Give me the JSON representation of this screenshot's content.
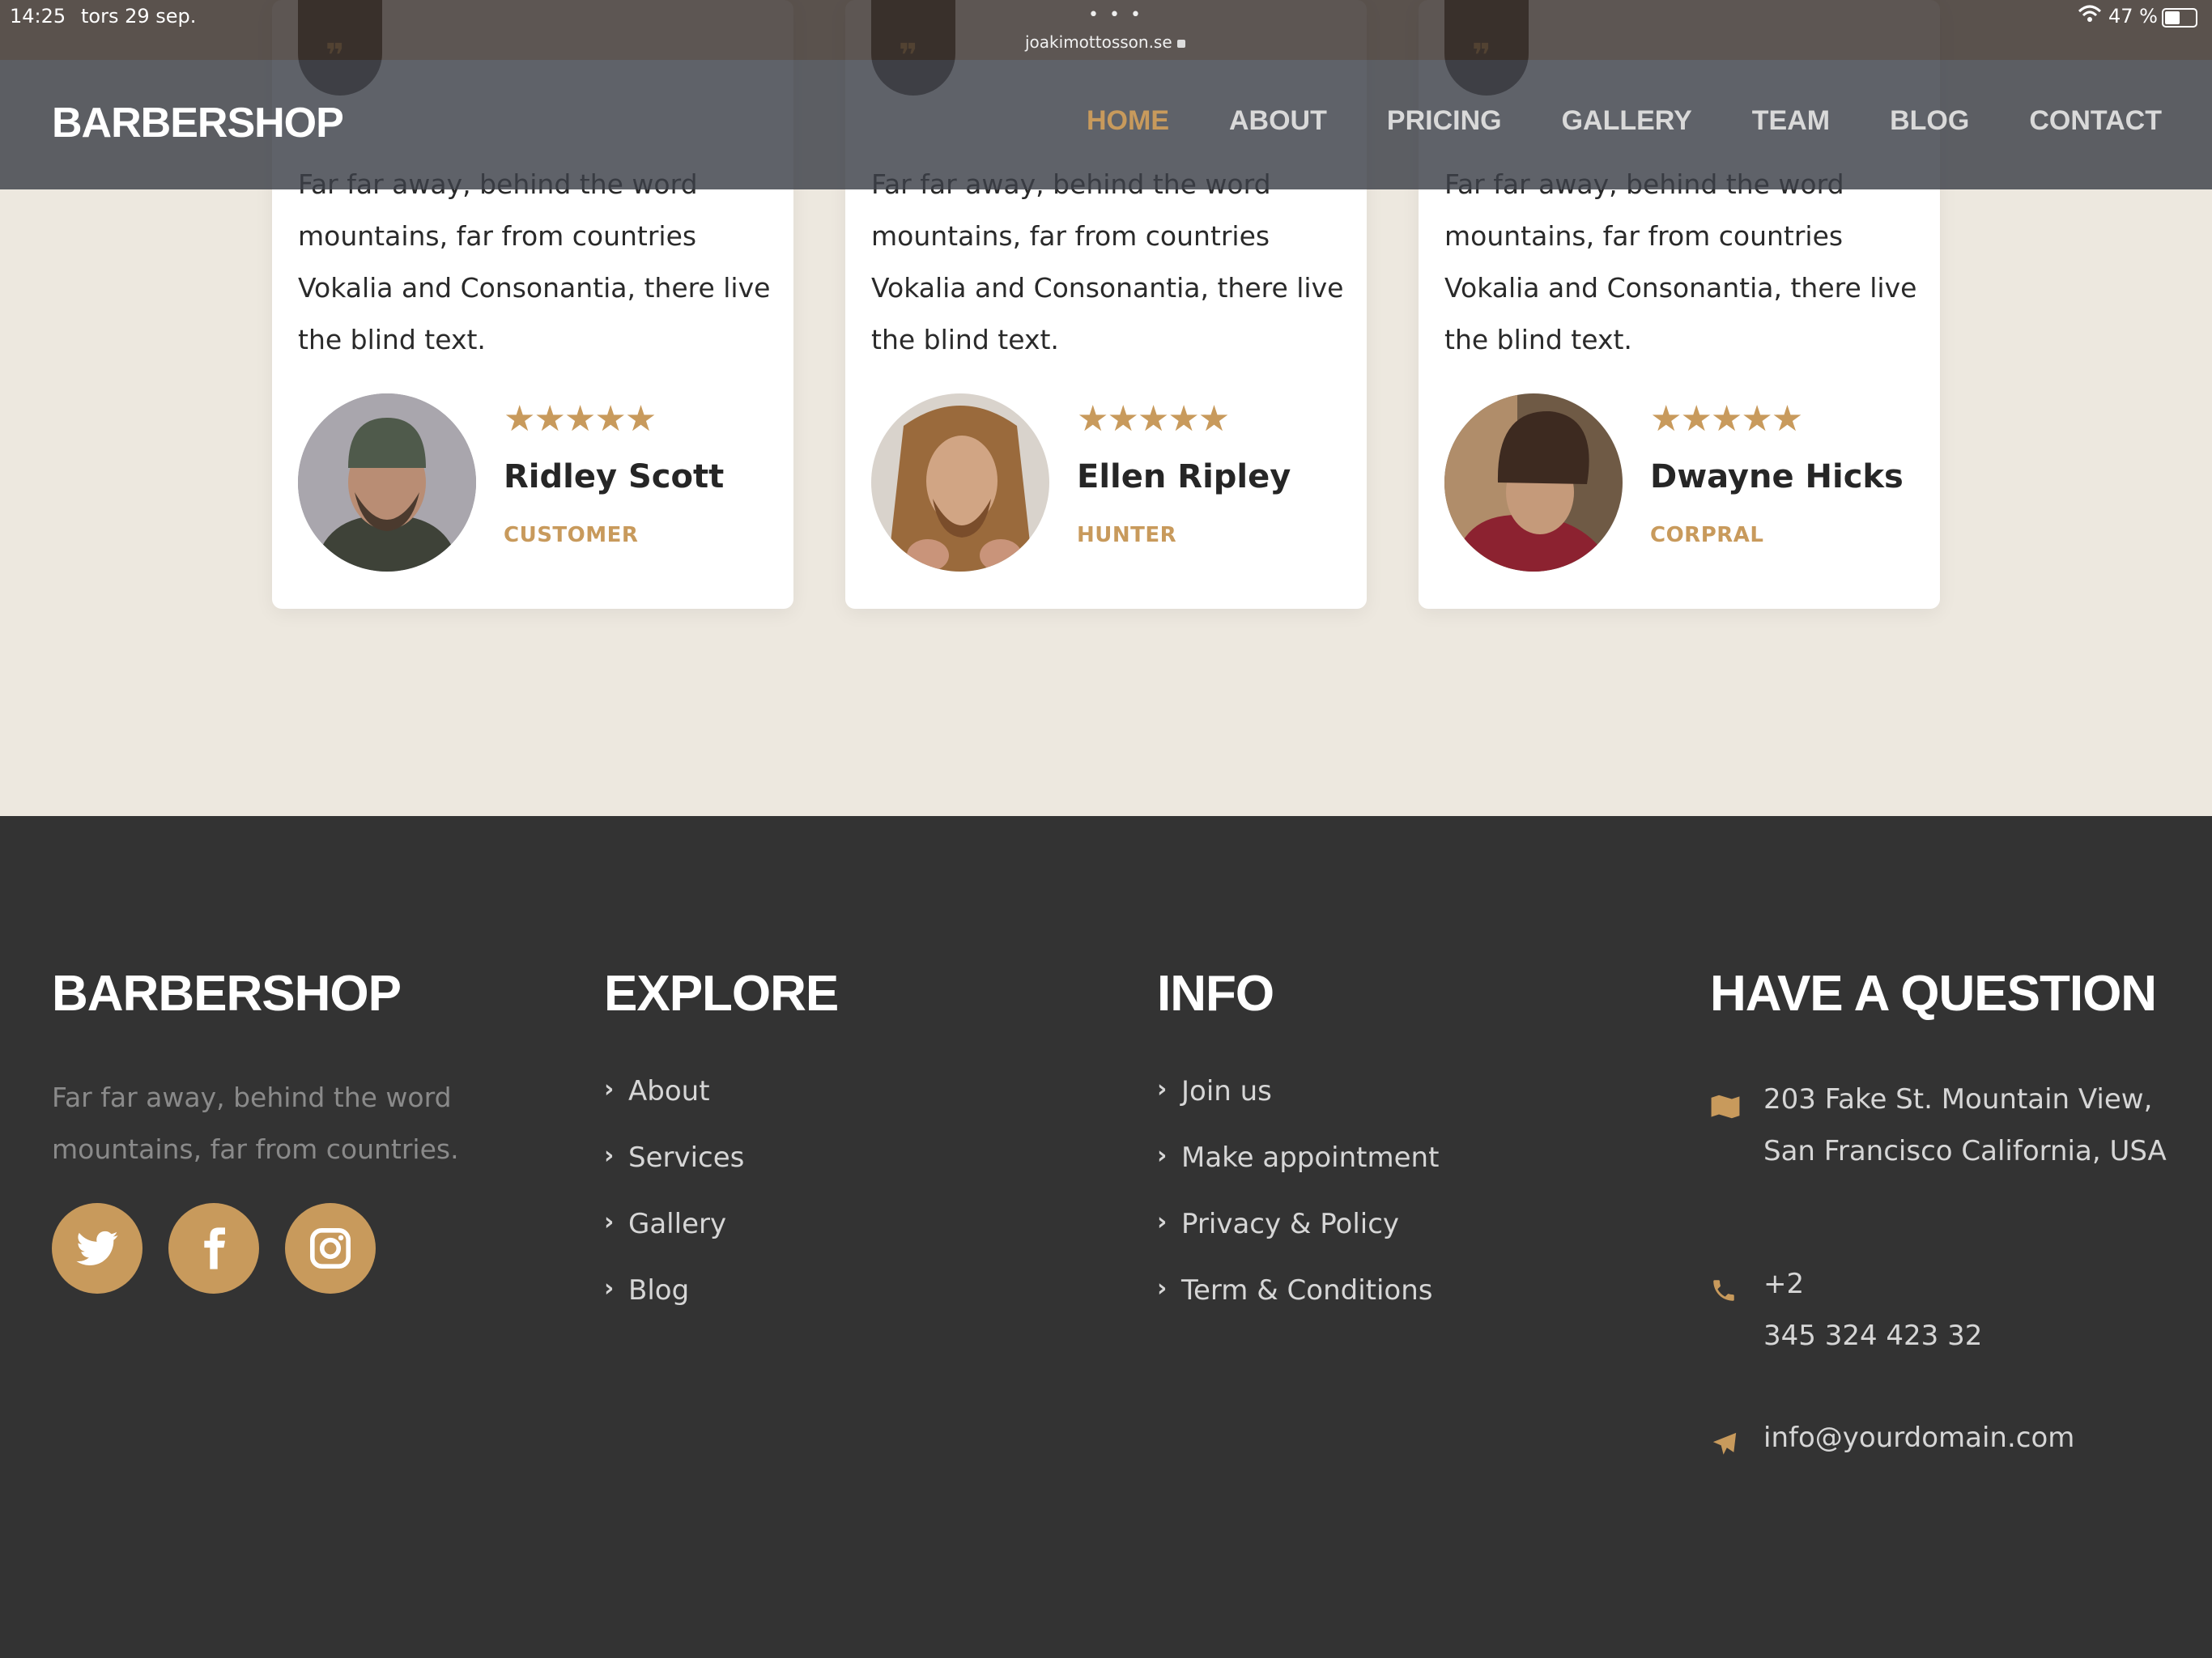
{
  "status_bar": {
    "time": "14:25",
    "date": "tors 29 sep.",
    "url": "joakimottosson.se",
    "battery": "47 %"
  },
  "nav": {
    "brand": "BARBERSHOP",
    "items": [
      "HOME",
      "ABOUT",
      "PRICING",
      "GALLERY",
      "TEAM",
      "BLOG",
      "CONTACT"
    ],
    "active": "HOME"
  },
  "testimonials": [
    {
      "text": "Far far away, behind the word mountains, far from countries Vokalia and Consonantia, there live the blind text.",
      "stars": "★★★★★",
      "name": "Ridley Scott",
      "role": "CUSTOMER"
    },
    {
      "text": "Far far away, behind the word mountains, far from countries Vokalia and Consonantia, there live the blind text.",
      "stars": "★★★★★",
      "name": "Ellen Ripley",
      "role": "HUNTER"
    },
    {
      "text": "Far far away, behind the word mountains, far from countries Vokalia and Consonantia, there live the blind text.",
      "stars": "★★★★★",
      "name": "Dwayne Hicks",
      "role": "CORPRAL"
    }
  ],
  "footer": {
    "brand": "BARBERSHOP",
    "about": "Far far away, behind the word mountains, far from countries.",
    "social": [
      "twitter-icon",
      "facebook-icon",
      "instagram-icon"
    ],
    "explore": {
      "title": "EXPLORE",
      "links": [
        "About",
        "Services",
        "Gallery",
        "Blog"
      ]
    },
    "info": {
      "title": "INFO",
      "links": [
        "Join us",
        "Make appointment",
        "Privacy & Policy",
        "Term & Conditions"
      ]
    },
    "question": {
      "title": "HAVE A QUESTION",
      "address": "203 Fake St. Mountain View, San Francisco California, USA",
      "phone_prefix": "+2",
      "phone": "345 324 423 32",
      "email": "info@yourdomain.com"
    }
  },
  "colors": {
    "accent": "#c89a5c",
    "section_bg": "#ede8df",
    "footer_bg": "#333333",
    "nav_bg": "#3c3f48"
  }
}
